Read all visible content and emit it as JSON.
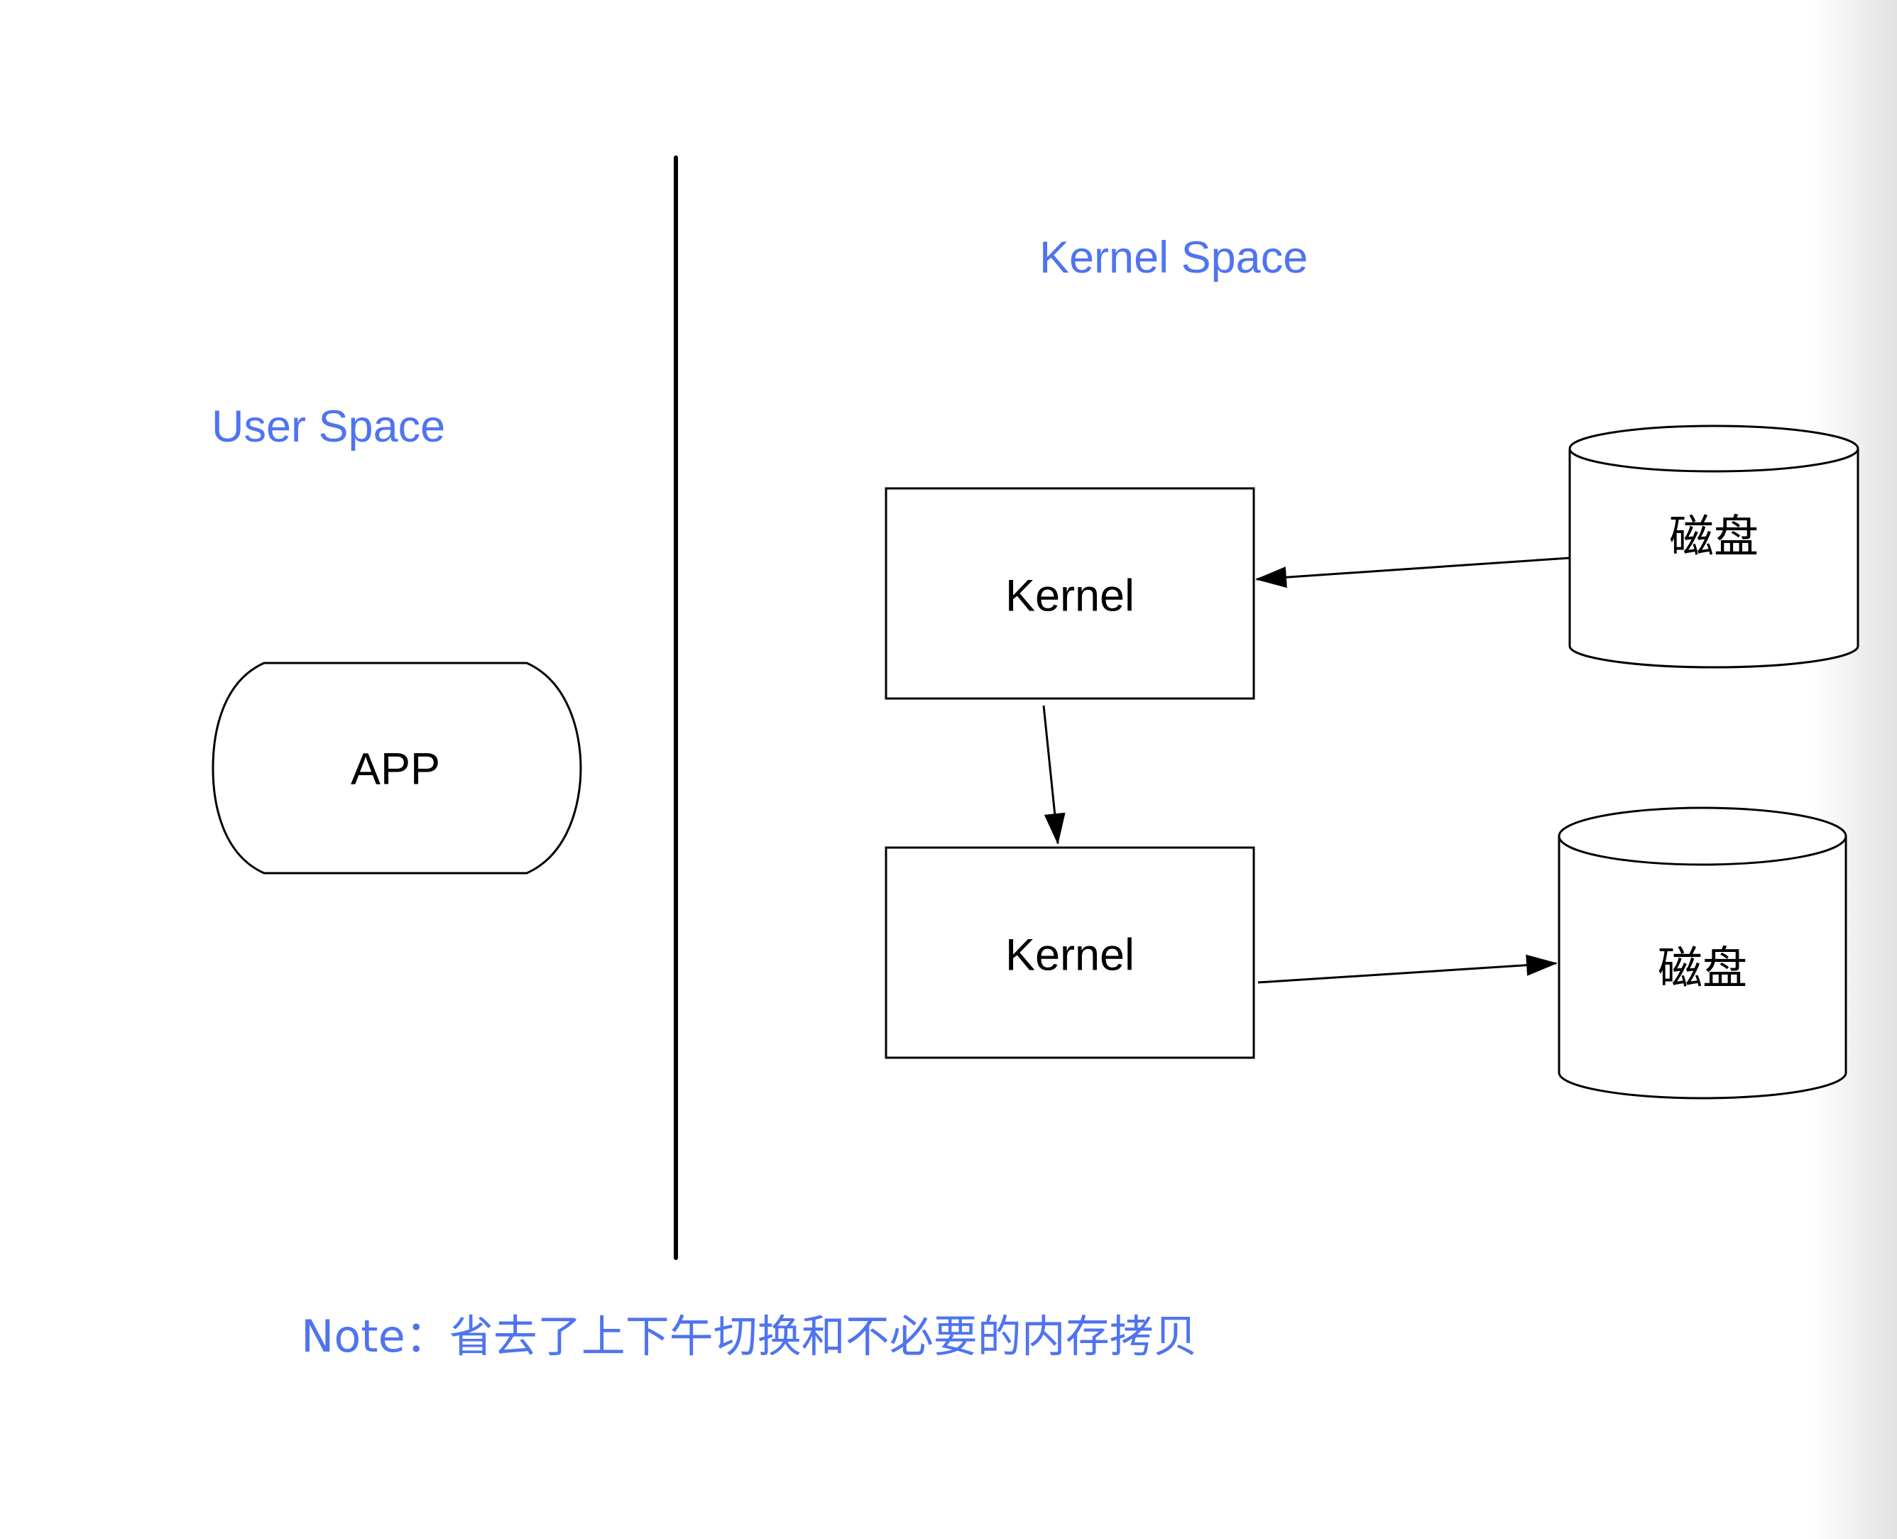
{
  "labels": {
    "user_space": "User Space",
    "kernel_space": "Kernel Space",
    "note": "Note：省去了上下午切换和不必要的内存拷贝"
  },
  "nodes": {
    "app": "APP",
    "kernel_top": "Kernel",
    "kernel_bottom": "Kernel",
    "disk_top": "磁盘",
    "disk_bottom": "磁盘"
  },
  "colors": {
    "label_blue": "#4f74f0",
    "stroke": "#000000",
    "background": "#ffffff"
  }
}
